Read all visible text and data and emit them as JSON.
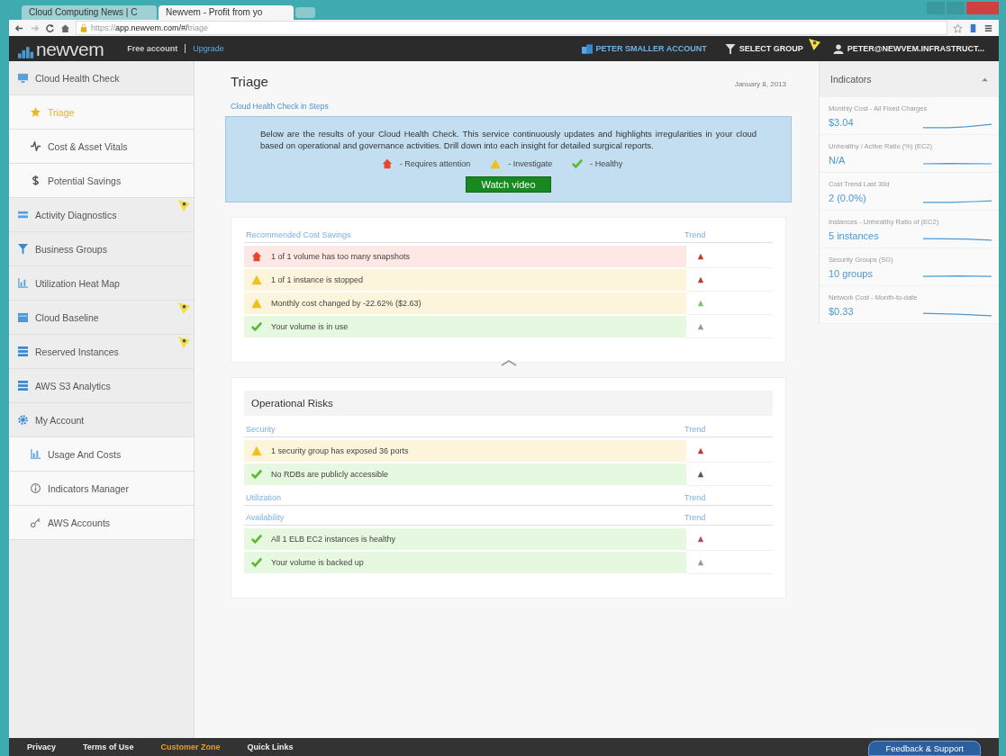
{
  "browser": {
    "tabs": [
      {
        "label": "Cloud Computing News | C",
        "selected": false
      },
      {
        "label": "Newvem - Profit from yo",
        "selected": true
      }
    ],
    "url_scheme": "https://",
    "url_host": "app.newvem.com/#/",
    "url_path": "triage"
  },
  "header": {
    "logo": "newvem",
    "account_plan": "Free account",
    "upgrade": "Upgrade",
    "account": "PETER SMALLER ACCOUNT",
    "group": "SELECT GROUP",
    "user": "PETER@NEWVEM.INFRASTRUCT..."
  },
  "sidebar": [
    {
      "label": "Cloud Health Check",
      "kind": "section",
      "selected": false,
      "flagged": false
    },
    {
      "label": "Triage",
      "kind": "sub",
      "selected": true,
      "flagged": false
    },
    {
      "label": "Cost & Asset Vitals",
      "kind": "sub",
      "selected": false,
      "flagged": false
    },
    {
      "label": "Potential Savings",
      "kind": "sub",
      "selected": false,
      "flagged": false
    },
    {
      "label": "Activity Diagnostics",
      "kind": "section",
      "selected": false,
      "flagged": true
    },
    {
      "label": "Business Groups",
      "kind": "section",
      "selected": false,
      "flagged": false
    },
    {
      "label": "Utilization Heat Map",
      "kind": "section",
      "selected": false,
      "flagged": false
    },
    {
      "label": "Cloud Baseline",
      "kind": "section",
      "selected": false,
      "flagged": true
    },
    {
      "label": "Reserved Instances",
      "kind": "section",
      "selected": false,
      "flagged": true
    },
    {
      "label": "AWS S3 Analytics",
      "kind": "section",
      "selected": false,
      "flagged": false
    },
    {
      "label": "My Account",
      "kind": "section",
      "selected": false,
      "flagged": false
    },
    {
      "label": "Usage And Costs",
      "kind": "sub",
      "selected": false,
      "flagged": false
    },
    {
      "label": "Indicators Manager",
      "kind": "sub",
      "selected": false,
      "flagged": false
    },
    {
      "label": "AWS Accounts",
      "kind": "sub",
      "selected": false,
      "flagged": false
    }
  ],
  "main": {
    "title": "Triage",
    "date": "January 8, 2013",
    "steps_link": "Cloud Health Check in Steps",
    "intro": "Below are the results of your Cloud Health Check. This service continuously updates and highlights irregularities in your cloud based on operational and governance activities. Drill down into each insight for detailed surgical reports.",
    "legend": [
      {
        "kind": "attention",
        "label": "- Requires attention"
      },
      {
        "kind": "investigate",
        "label": "- Investigate"
      },
      {
        "kind": "healthy",
        "label": "- Healthy"
      }
    ],
    "video_button": "Watch video",
    "cards": [
      {
        "sections": [
          {
            "heading": "Recommended Cost Savings",
            "trend_heading": "Trend",
            "rows": [
              {
                "kind": "attention",
                "text": "1 of 1 volume has too many snapshots",
                "color": "#c0392b"
              },
              {
                "kind": "investigate",
                "text": "1 of 1 instance is stopped",
                "color": "#c0392b"
              },
              {
                "kind": "investigate",
                "text": "Monthly cost changed by -22.62% ($2.63)",
                "color": "#7cc46a"
              },
              {
                "kind": "healthy",
                "text": "Your volume is in use",
                "color": "#999999"
              }
            ]
          }
        ]
      },
      {
        "title": "Operational Risks",
        "sections": [
          {
            "heading": "Security",
            "trend_heading": "Trend",
            "rows": [
              {
                "kind": "investigate",
                "text": "1 security group has exposed 36 ports",
                "color": "#c0392b"
              },
              {
                "kind": "healthy",
                "text": "No RDBs are publicly accessible",
                "color": "#555555"
              }
            ]
          },
          {
            "heading": "Utilization",
            "trend_heading": "Trend"
          },
          {
            "heading": "Availability",
            "trend_heading": "Trend",
            "rows": [
              {
                "kind": "healthy",
                "text": "All 1 ELB EC2 instances is healthy",
                "color": "#a05070"
              },
              {
                "kind": "healthy",
                "text": "Your volume is backed up",
                "color": "#999999"
              }
            ]
          }
        ]
      }
    ]
  },
  "indicators": {
    "title": "Indicators",
    "items": [
      {
        "label": "Monthly Cost - All Fixed Charges",
        "value": "$3.04"
      },
      {
        "label": "Unhealthy / Active Ratio (%) (EC2)",
        "value": "N/A"
      },
      {
        "label": "Cost Trend Last 30d",
        "value": "2 (0.0%)"
      },
      {
        "label": "Instances - Unhealthy Ratio of (EC2)",
        "value": "5 instances"
      },
      {
        "label": "Security Groups (SG)",
        "value": "10 groups"
      },
      {
        "label": "Network Cost - Month-to-date",
        "value": "$0.33"
      }
    ]
  },
  "footer": {
    "links": [
      {
        "label": "Privacy",
        "kind": "plain"
      },
      {
        "label": "Terms of Use",
        "kind": "plain"
      },
      {
        "label": "Customer Zone",
        "kind": "accent"
      },
      {
        "label": "Quick Links",
        "kind": "plain"
      }
    ],
    "feedback": "Feedback & Support"
  }
}
